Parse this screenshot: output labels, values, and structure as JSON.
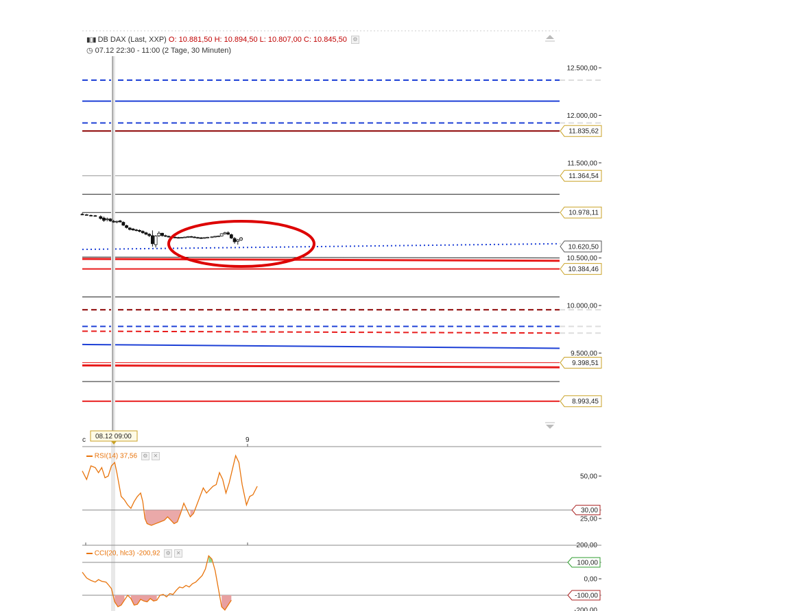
{
  "header": {
    "instrument": "DB DAX (Last, XXP)",
    "open": "O: 10.881,50",
    "high": "H: 10.894,50",
    "low": "L: 10.807,00",
    "close": "C: 10.845,50",
    "period": "07.12 22:30 - 11:00 (2 Tage, 30 Minuten)"
  },
  "crosshair_label": "08.12 09:00",
  "x_ticks": [
    "9"
  ],
  "colors": {
    "blue": "#1c3fd6",
    "red": "#e81c1c",
    "dark_red": "#8b0000",
    "orange": "#e8740c",
    "rsi_fill": "#e8a0a0",
    "cci_pos_fill": "#90d890",
    "annotation": "#dd0000"
  },
  "chart_data": [
    {
      "type": "line",
      "name": "price",
      "y_ticks": [
        {
          "value": 12500,
          "label": "12.500,00"
        },
        {
          "value": 12000,
          "label": "12.000,00"
        },
        {
          "value": 11500,
          "label": "11.500,00"
        },
        {
          "value": 10500,
          "label": "10.500,00"
        },
        {
          "value": 10000,
          "label": "10.000,00"
        },
        {
          "value": 9500,
          "label": "9.500,00"
        }
      ],
      "price_tags": [
        {
          "value": 11835.62,
          "label": "11.835,62",
          "border": "#c9a227"
        },
        {
          "value": 11364.54,
          "label": "11.364,54",
          "border": "#c9a227"
        },
        {
          "value": 10978.11,
          "label": "10.978,11",
          "border": "#c9a227"
        },
        {
          "value": 10620.5,
          "label": "10.620,50",
          "border": "#555555"
        },
        {
          "value": 10384.46,
          "label": "10.384,46",
          "border": "#c9a227"
        },
        {
          "value": 9398.51,
          "label": "9.398,51",
          "border": "#c9a227"
        },
        {
          "value": 8993.45,
          "label": "8.993,45",
          "border": "#c9a227"
        }
      ],
      "levels": [
        {
          "from": 12370,
          "to": 12370,
          "color": "blue",
          "style": "dashed",
          "width": 2
        },
        {
          "from": 12150,
          "to": 12150,
          "color": "blue",
          "style": "solid",
          "width": 2
        },
        {
          "from": 11920,
          "to": 11920,
          "color": "blue",
          "style": "dashed",
          "width": 2
        },
        {
          "from": 11835.62,
          "to": 11835.62,
          "color": "dark_red",
          "style": "solid",
          "width": 2
        },
        {
          "from": 11364.54,
          "to": 11364.54,
          "color": "gray",
          "style": "solid",
          "width": 1
        },
        {
          "from": 11170,
          "to": 11170,
          "color": "black",
          "style": "solid",
          "width": 1
        },
        {
          "from": 10978.11,
          "to": 10978.11,
          "color": "black",
          "style": "solid",
          "width": 1
        },
        {
          "from": 10590,
          "to": 10650,
          "color": "blue",
          "style": "dotted",
          "width": 2
        },
        {
          "from": 10510,
          "to": 10500,
          "color": "black",
          "style": "solid",
          "width": 1
        },
        {
          "from": 10490,
          "to": 10470,
          "color": "red",
          "style": "solid",
          "width": 3
        },
        {
          "from": 10384.46,
          "to": 10384.46,
          "color": "red",
          "style": "solid",
          "width": 2
        },
        {
          "from": 10090,
          "to": 10090,
          "color": "black",
          "style": "solid",
          "width": 1
        },
        {
          "from": 9955,
          "to": 9955,
          "color": "dark_red",
          "style": "dashed",
          "width": 2
        },
        {
          "from": 9780,
          "to": 9780,
          "color": "blue",
          "style": "dashed",
          "width": 2
        },
        {
          "from": 9730,
          "to": 9710,
          "color": "red",
          "style": "dashed",
          "width": 2
        },
        {
          "from": 9590,
          "to": 9550,
          "color": "blue",
          "style": "solid",
          "width": 2
        },
        {
          "from": 9398.51,
          "to": 9398.51,
          "color": "red",
          "style": "solid",
          "width": 1
        },
        {
          "from": 9370,
          "to": 9350,
          "color": "red",
          "style": "solid",
          "width": 3
        },
        {
          "from": 9200,
          "to": 9200,
          "color": "black",
          "style": "solid",
          "width": 1
        },
        {
          "from": 8993.45,
          "to": 8993.45,
          "color": "red",
          "style": "solid",
          "width": 2
        }
      ],
      "candles": [
        {
          "t": 0.0,
          "o": 10960,
          "h": 10975,
          "l": 10950,
          "c": 10958
        },
        {
          "t": 0.02,
          "o": 10955,
          "h": 10962,
          "l": 10948,
          "c": 10950
        },
        {
          "t": 0.04,
          "o": 10948,
          "h": 10956,
          "l": 10940,
          "c": 10945
        },
        {
          "t": 0.06,
          "o": 10945,
          "h": 10952,
          "l": 10935,
          "c": 10940
        },
        {
          "t": 0.085,
          "o": 10935,
          "h": 10948,
          "l": 10905,
          "c": 10915
        },
        {
          "t": 0.1,
          "o": 10920,
          "h": 10935,
          "l": 10880,
          "c": 10895
        },
        {
          "t": 0.115,
          "o": 10905,
          "h": 10925,
          "l": 10885,
          "c": 10910
        },
        {
          "t": 0.13,
          "o": 10910,
          "h": 10920,
          "l": 10880,
          "c": 10890
        },
        {
          "t": 0.145,
          "o": 10885,
          "h": 10900,
          "l": 10870,
          "c": 10878
        },
        {
          "t": 0.16,
          "o": 10880,
          "h": 10892,
          "l": 10865,
          "c": 10885
        },
        {
          "t": 0.175,
          "o": 10890,
          "h": 10900,
          "l": 10870,
          "c": 10880
        },
        {
          "t": 0.19,
          "o": 10875,
          "h": 10885,
          "l": 10835,
          "c": 10845
        },
        {
          "t": 0.205,
          "o": 10840,
          "h": 10850,
          "l": 10810,
          "c": 10820
        },
        {
          "t": 0.22,
          "o": 10815,
          "h": 10825,
          "l": 10790,
          "c": 10800
        },
        {
          "t": 0.235,
          "o": 10805,
          "h": 10815,
          "l": 10785,
          "c": 10795
        },
        {
          "t": 0.25,
          "o": 10795,
          "h": 10805,
          "l": 10780,
          "c": 10790
        },
        {
          "t": 0.265,
          "o": 10790,
          "h": 10800,
          "l": 10770,
          "c": 10780
        },
        {
          "t": 0.28,
          "o": 10780,
          "h": 10790,
          "l": 10755,
          "c": 10765
        },
        {
          "t": 0.295,
          "o": 10765,
          "h": 10775,
          "l": 10740,
          "c": 10750
        },
        {
          "t": 0.31,
          "o": 10750,
          "h": 10760,
          "l": 10720,
          "c": 10735
        },
        {
          "t": 0.325,
          "o": 10735,
          "h": 10790,
          "l": 10620,
          "c": 10650
        },
        {
          "t": 0.34,
          "o": 10640,
          "h": 10740,
          "l": 10610,
          "c": 10730
        },
        {
          "t": 0.355,
          "o": 10735,
          "h": 10780,
          "l": 10720,
          "c": 10760
        },
        {
          "t": 0.37,
          "o": 10760,
          "h": 10765,
          "l": 10725,
          "c": 10735
        },
        {
          "t": 0.385,
          "o": 10735,
          "h": 10745,
          "l": 10720,
          "c": 10728
        },
        {
          "t": 0.4,
          "o": 10728,
          "h": 10735,
          "l": 10715,
          "c": 10720
        },
        {
          "t": 0.415,
          "o": 10720,
          "h": 10728,
          "l": 10712,
          "c": 10718
        },
        {
          "t": 0.43,
          "o": 10718,
          "h": 10725,
          "l": 10710,
          "c": 10715
        },
        {
          "t": 0.445,
          "o": 10715,
          "h": 10722,
          "l": 10705,
          "c": 10712
        },
        {
          "t": 0.46,
          "o": 10712,
          "h": 10720,
          "l": 10705,
          "c": 10716
        },
        {
          "t": 0.475,
          "o": 10716,
          "h": 10724,
          "l": 10710,
          "c": 10720
        },
        {
          "t": 0.49,
          "o": 10720,
          "h": 10730,
          "l": 10712,
          "c": 10725
        },
        {
          "t": 0.505,
          "o": 10725,
          "h": 10732,
          "l": 10715,
          "c": 10720
        },
        {
          "t": 0.52,
          "o": 10720,
          "h": 10728,
          "l": 10710,
          "c": 10715
        },
        {
          "t": 0.535,
          "o": 10715,
          "h": 10722,
          "l": 10705,
          "c": 10712
        },
        {
          "t": 0.55,
          "o": 10712,
          "h": 10720,
          "l": 10700,
          "c": 10710
        },
        {
          "t": 0.565,
          "o": 10710,
          "h": 10718,
          "l": 10702,
          "c": 10714
        },
        {
          "t": 0.58,
          "o": 10714,
          "h": 10722,
          "l": 10708,
          "c": 10718
        },
        {
          "t": 0.6,
          "o": 10718,
          "h": 10726,
          "l": 10712,
          "c": 10722
        },
        {
          "t": 0.615,
          "o": 10722,
          "h": 10730,
          "l": 10715,
          "c": 10728
        },
        {
          "t": 0.63,
          "o": 10728,
          "h": 10735,
          "l": 10720,
          "c": 10730
        },
        {
          "t": 0.645,
          "o": 10730,
          "h": 10760,
          "l": 10725,
          "c": 10755
        },
        {
          "t": 0.66,
          "o": 10755,
          "h": 10775,
          "l": 10745,
          "c": 10765
        },
        {
          "t": 0.675,
          "o": 10765,
          "h": 10780,
          "l": 10740,
          "c": 10750
        },
        {
          "t": 0.69,
          "o": 10745,
          "h": 10755,
          "l": 10700,
          "c": 10710
        },
        {
          "t": 0.705,
          "o": 10705,
          "h": 10720,
          "l": 10650,
          "c": 10670
        },
        {
          "t": 0.72,
          "o": 10675,
          "h": 10700,
          "l": 10640,
          "c": 10690
        },
        {
          "t": 0.735,
          "o": 10690,
          "h": 10720,
          "l": 10680,
          "c": 10710
        }
      ]
    },
    {
      "type": "line",
      "name": "RSI(14)",
      "header": "RSI(14)",
      "last": "37,56",
      "y_ticks": [
        {
          "value": 50,
          "label": "50,00"
        },
        {
          "value": 25,
          "label": "25,00"
        }
      ],
      "extra_tick": "200,00",
      "threshold": {
        "value": 30,
        "label": "30,00"
      },
      "values": [
        53,
        48,
        56,
        55,
        52,
        55,
        49,
        50,
        56,
        58,
        52,
        45,
        38,
        36,
        33,
        31,
        35,
        38,
        40,
        35,
        25,
        22,
        21,
        22,
        23,
        24,
        26,
        24,
        22,
        23,
        28,
        34,
        30,
        26,
        28,
        33,
        38,
        43,
        40,
        42,
        44,
        45,
        52,
        48,
        40,
        46,
        54,
        62,
        58,
        45,
        33,
        38,
        39,
        44
      ],
      "x": [
        0.0,
        0.02,
        0.04,
        0.06,
        0.075,
        0.09,
        0.105,
        0.12,
        0.135,
        0.15,
        0.16,
        0.17,
        0.18,
        0.195,
        0.21,
        0.225,
        0.24,
        0.255,
        0.27,
        0.28,
        0.29,
        0.3,
        0.32,
        0.34,
        0.36,
        0.38,
        0.395,
        0.41,
        0.425,
        0.44,
        0.455,
        0.47,
        0.485,
        0.5,
        0.515,
        0.53,
        0.545,
        0.56,
        0.575,
        0.59,
        0.605,
        0.62,
        0.635,
        0.65,
        0.665,
        0.68,
        0.695,
        0.71,
        0.725,
        0.74,
        0.76,
        0.775,
        0.79,
        0.81
      ]
    },
    {
      "type": "line",
      "name": "CCI(20, hlc3)",
      "header": "CCI(20, hlc3)",
      "last": "-200,92",
      "y_ticks": [
        {
          "value": 0,
          "label": "0,00"
        }
      ],
      "top_tick": "200,00",
      "bottom_tick": "-200,00",
      "thresholds": [
        {
          "value": 100,
          "label": "100,00",
          "border": "#2e9e2e"
        },
        {
          "value": -100,
          "label": "-100,00",
          "border": "#aa2222"
        }
      ],
      "values": [
        40,
        5,
        -10,
        -20,
        -5,
        -15,
        -20,
        -35,
        -60,
        -140,
        -170,
        -160,
        -130,
        -100,
        -120,
        -160,
        -155,
        -125,
        -135,
        -140,
        -120,
        -135,
        -130,
        -100,
        -95,
        -110,
        -90,
        -95,
        -70,
        -50,
        -55,
        -40,
        -50,
        -30,
        -20,
        0,
        20,
        60,
        140,
        120,
        50,
        -60,
        -170,
        -190,
        -160,
        -130
      ],
      "x": [
        0.0,
        0.02,
        0.04,
        0.06,
        0.075,
        0.09,
        0.11,
        0.12,
        0.135,
        0.15,
        0.165,
        0.18,
        0.195,
        0.21,
        0.225,
        0.24,
        0.255,
        0.27,
        0.285,
        0.3,
        0.315,
        0.33,
        0.345,
        0.36,
        0.375,
        0.39,
        0.405,
        0.42,
        0.435,
        0.45,
        0.465,
        0.48,
        0.495,
        0.51,
        0.525,
        0.54,
        0.555,
        0.57,
        0.585,
        0.6,
        0.615,
        0.63,
        0.645,
        0.66,
        0.675,
        0.69
      ]
    }
  ]
}
